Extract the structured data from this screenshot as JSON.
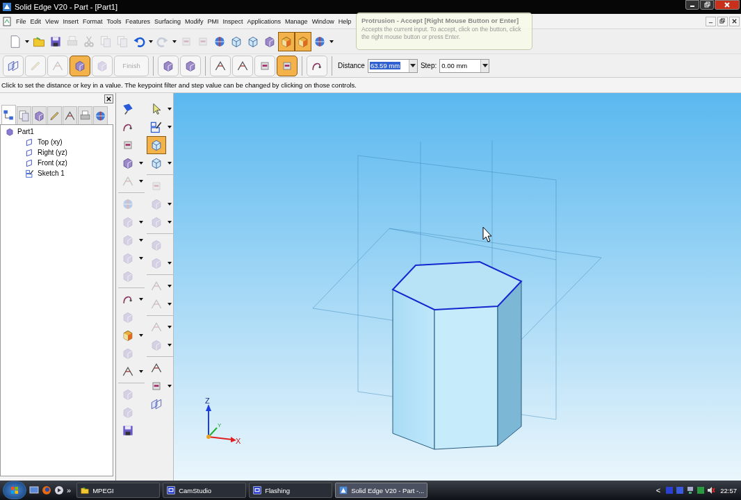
{
  "window": {
    "title": "Solid Edge V20 - Part - [Part1]"
  },
  "menu": [
    "File",
    "Edit",
    "View",
    "Insert",
    "Format",
    "Tools",
    "Features",
    "Surfacing",
    "Modify",
    "PMI",
    "Inspect",
    "Applications",
    "Manage",
    "Window",
    "Help"
  ],
  "toolbar": [
    {
      "kind": "page",
      "disabled": false,
      "pressed": false,
      "menu": true
    },
    {
      "kind": "folder",
      "disabled": false,
      "pressed": false,
      "menu": false
    },
    {
      "kind": "disk",
      "disabled": false,
      "pressed": false,
      "menu": false
    },
    {
      "kind": "printer",
      "disabled": true,
      "pressed": false,
      "menu": false
    },
    {
      "kind": "scissors",
      "disabled": true,
      "pressed": false,
      "menu": false
    },
    {
      "kind": "pages",
      "disabled": true,
      "pressed": false,
      "menu": false
    },
    {
      "kind": "pages",
      "disabled": true,
      "pressed": false,
      "menu": false
    },
    {
      "kind": "undo",
      "disabled": false,
      "pressed": false,
      "menu": true
    },
    {
      "kind": "redo",
      "disabled": true,
      "pressed": false,
      "menu": true
    },
    {
      "kind": "square",
      "disabled": true,
      "pressed": false,
      "menu": false
    },
    {
      "kind": "square",
      "disabled": true,
      "pressed": false,
      "menu": false
    },
    {
      "kind": "sphere",
      "disabled": false,
      "pressed": false,
      "menu": false
    },
    {
      "kind": "cube",
      "disabled": false,
      "pressed": false,
      "menu": false
    },
    {
      "kind": "cube",
      "disabled": false,
      "pressed": false,
      "menu": false
    },
    {
      "kind": "solid",
      "disabled": false,
      "pressed": false,
      "menu": false
    },
    {
      "kind": "shaded",
      "disabled": false,
      "pressed": true,
      "menu": false
    },
    {
      "kind": "shaded",
      "disabled": false,
      "pressed": true,
      "menu": false
    },
    {
      "kind": "sphere",
      "disabled": false,
      "pressed": false,
      "menu": true
    }
  ],
  "ribbon": [
    {
      "kind": "plane",
      "disabled": false,
      "pressed": false
    },
    {
      "kind": "pencil",
      "disabled": true,
      "pressed": false
    },
    {
      "kind": "lines",
      "disabled": true,
      "pressed": false
    },
    {
      "kind": "solid",
      "disabled": false,
      "pressed": true
    },
    {
      "kind": "solid",
      "disabled": true,
      "pressed": false
    },
    {
      "kind": "finish",
      "label": "Finish",
      "disabled": true,
      "pressed": false
    },
    {
      "kind": "separator"
    },
    {
      "kind": "solid",
      "disabled": false,
      "pressed": false
    },
    {
      "kind": "solid",
      "disabled": false,
      "pressed": false
    },
    {
      "kind": "separator"
    },
    {
      "kind": "lines",
      "disabled": false,
      "pressed": false
    },
    {
      "kind": "lines",
      "disabled": false,
      "pressed": false
    },
    {
      "kind": "square",
      "disabled": false,
      "pressed": false
    },
    {
      "kind": "square",
      "disabled": false,
      "pressed": true
    },
    {
      "kind": "separator"
    },
    {
      "kind": "curve",
      "disabled": false,
      "pressed": false
    },
    {
      "kind": "separator"
    }
  ],
  "distance": {
    "label": "Distance",
    "value": "63.59 mm"
  },
  "step": {
    "label": "Step:",
    "value": "0.00 mm"
  },
  "tooltip": {
    "title": "Protrusion - Accept [Right Mouse Button or Enter]",
    "text": "Accepts the current input.  To accept, click on the button, click the right mouse button or press Enter."
  },
  "prompt": "Click to set the distance or key in a value. The keypoint filter and step value can be changed by clicking on those controls.",
  "pathfinder": {
    "tabs": [
      {
        "kind": "tree",
        "selected": true
      },
      {
        "kind": "pages",
        "selected": false
      },
      {
        "kind": "solid",
        "selected": false
      },
      {
        "kind": "pencil",
        "selected": false
      },
      {
        "kind": "lines",
        "selected": false
      },
      {
        "kind": "printer",
        "selected": false
      },
      {
        "kind": "sphere",
        "selected": false
      }
    ],
    "tree": [
      {
        "label": "Part1",
        "kind": "part",
        "children": [
          {
            "label": "Top (xy)",
            "kind": "plane"
          },
          {
            "label": "Right (yz)",
            "kind": "plane"
          },
          {
            "label": "Front (xz)",
            "kind": "plane"
          },
          {
            "label": "Sketch 1",
            "kind": "sketch"
          }
        ]
      }
    ]
  },
  "features": [
    {
      "kind": "pin",
      "disabled": false,
      "menu": false
    },
    {
      "kind": "curve",
      "disabled": false,
      "menu": false
    },
    {
      "kind": "square",
      "disabled": false,
      "menu": false
    },
    {
      "kind": "solid",
      "disabled": false,
      "menu": true
    },
    {
      "kind": "lines",
      "disabled": true,
      "menu": true
    },
    {
      "kind": "separator"
    },
    {
      "kind": "sphere",
      "disabled": true,
      "menu": false
    },
    {
      "kind": "solid",
      "disabled": true,
      "menu": true
    },
    {
      "kind": "solid",
      "disabled": true,
      "menu": true
    },
    {
      "kind": "solid",
      "disabled": true,
      "menu": true
    },
    {
      "kind": "solid",
      "disabled": true,
      "menu": false
    },
    {
      "kind": "separator"
    },
    {
      "kind": "curve",
      "disabled": false,
      "menu": true
    },
    {
      "kind": "solid",
      "disabled": true,
      "menu": false
    },
    {
      "kind": "shaded",
      "disabled": false,
      "menu": true
    },
    {
      "kind": "solid",
      "disabled": true,
      "menu": false
    },
    {
      "kind": "lines",
      "disabled": false,
      "menu": true
    },
    {
      "kind": "separator"
    },
    {
      "kind": "solid",
      "disabled": true,
      "menu": false
    },
    {
      "kind": "solid",
      "disabled": true,
      "menu": false
    },
    {
      "kind": "disk",
      "disabled": false,
      "menu": false
    }
  ],
  "tools": [
    {
      "kind": "pointer",
      "disabled": false,
      "pressed": false,
      "menu": true
    },
    {
      "kind": "sketch",
      "disabled": false,
      "pressed": false,
      "menu": true
    },
    {
      "kind": "cube",
      "disabled": false,
      "pressed": true,
      "menu": false
    },
    {
      "kind": "cube",
      "disabled": false,
      "pressed": false,
      "menu": true
    },
    {
      "kind": "separator"
    },
    {
      "kind": "square",
      "disabled": true,
      "pressed": false,
      "menu": false
    },
    {
      "kind": "solid",
      "disabled": true,
      "pressed": false,
      "menu": true
    },
    {
      "kind": "solid",
      "disabled": true,
      "pressed": false,
      "menu": true
    },
    {
      "kind": "separator"
    },
    {
      "kind": "solid",
      "disabled": true,
      "pressed": false,
      "menu": false
    },
    {
      "kind": "solid",
      "disabled": true,
      "pressed": false,
      "menu": true
    },
    {
      "kind": "separator"
    },
    {
      "kind": "lines",
      "disabled": true,
      "pressed": false,
      "menu": true
    },
    {
      "kind": "lines",
      "disabled": true,
      "pressed": false,
      "menu": true
    },
    {
      "kind": "separator"
    },
    {
      "kind": "lines",
      "disabled": true,
      "pressed": false,
      "menu": true
    },
    {
      "kind": "solid",
      "disabled": true,
      "pressed": false,
      "menu": true
    },
    {
      "kind": "separator"
    },
    {
      "kind": "lines",
      "disabled": false,
      "pressed": false,
      "menu": false
    },
    {
      "kind": "square",
      "disabled": false,
      "pressed": false,
      "menu": true
    },
    {
      "kind": "plane",
      "disabled": false,
      "pressed": false,
      "menu": false
    }
  ],
  "triad": {
    "z": "Z",
    "y": "Y",
    "x": "X"
  },
  "taskbar": {
    "quick": "»",
    "tasks": [
      {
        "label": "MPEGI",
        "kind": "folder",
        "selected": false
      },
      {
        "label": "CamStudio",
        "kind": "app",
        "selected": false
      },
      {
        "label": "Flashing",
        "kind": "app",
        "selected": false
      },
      {
        "label": "Solid Edge V20 - Part -...",
        "kind": "cad",
        "selected": true
      }
    ],
    "tray_arrow": "<",
    "time": "22:57"
  }
}
